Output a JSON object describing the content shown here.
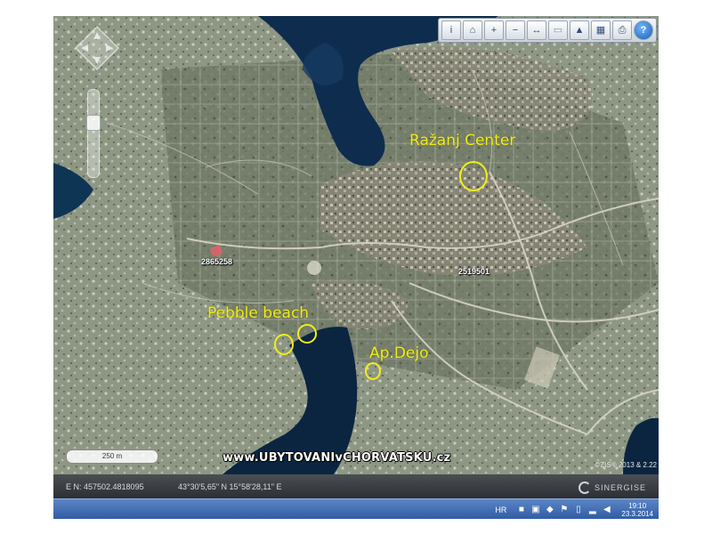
{
  "toolbar": {
    "buttons": [
      {
        "name": "parcel-info-icon",
        "glyph": "i"
      },
      {
        "name": "home-icon",
        "glyph": "⌂"
      },
      {
        "name": "zoom-in-icon",
        "glyph": "+"
      },
      {
        "name": "zoom-out-icon",
        "glyph": "−"
      },
      {
        "name": "measure-icon",
        "glyph": "↔"
      },
      {
        "name": "layers-icon",
        "glyph": "▭"
      },
      {
        "name": "overview-icon",
        "glyph": "▲"
      },
      {
        "name": "table-icon",
        "glyph": "▦"
      },
      {
        "name": "print-icon",
        "glyph": "⎙"
      },
      {
        "name": "help-icon",
        "glyph": "?"
      }
    ]
  },
  "map": {
    "scale_label": "250 m",
    "watermark": "www.UBYTOVANIvCHORVATSKU.cz",
    "copyright": "©ZIS® 2013 & 2.22",
    "parcel_labels": [
      "2865258",
      "2519501"
    ],
    "annotations": {
      "center": "Ražanj Center",
      "beach": "Pebble beach",
      "apartment": "Ap.Dejo"
    },
    "annotation_color": "#f2ee1a"
  },
  "status": {
    "en_coords": "E N: 457502.4818095",
    "geo_coords": "43°30'5,65\" N 15°58'28,11\" E",
    "brand": "SINERGISE"
  },
  "taskbar": {
    "lang": "HR",
    "time": "19:10",
    "date": "23.3.2014"
  }
}
